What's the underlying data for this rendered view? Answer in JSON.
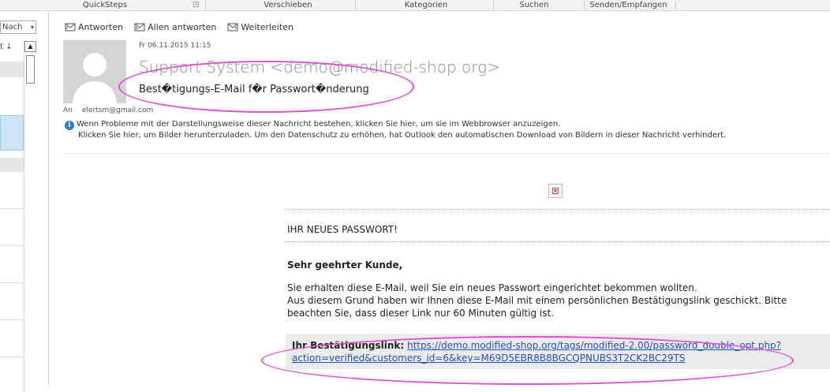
{
  "ribbon": {
    "groups": [
      "QuickSteps",
      "Verschieben",
      "Kategorien",
      "Suchen",
      "Senden/Empfangen"
    ]
  },
  "list": {
    "sort_label": "Nach",
    "sort_arrow": "t ↓"
  },
  "actions": {
    "reply": "Antworten",
    "reply_all": "Allen antworten",
    "forward": "Weiterleiten"
  },
  "message": {
    "date": "Fr 06.11.2015 11:15",
    "sender": "Support System <demo@modified-shop.org>",
    "subject": "Best�tigungs-E-Mail f�r Passwort�nderung",
    "to_label": "An",
    "to_address": "elertsm@gmail.com",
    "info_line1": "Wenn Probleme mit der Darstellungsweise dieser Nachricht bestehen, klicken Sie hier, um sie im Webbrowser anzuzeigen.",
    "info_line2": "Klicken Sie hier, um Bilder herunterzuladen. Um den Datenschutz zu erhöhen, hat Outlook den automatischen Download von Bildern in dieser Nachricht verhindert."
  },
  "body": {
    "heading": "IHR NEUES PASSWORT!",
    "greeting": "Sehr geehrter Kunde,",
    "para1": "Sie erhalten diese E-Mail, weil Sie ein neues Passwort eingerichtet bekommen wollten.",
    "para2": "Aus diesem Grund haben wir Ihnen diese E-Mail mit einem persönlichen Bestätigungslink geschickt. Bitte beachten Sie, dass dieser Link nur 60 Minuten gültig ist.",
    "link_label": "Ihr Bestätigungslink:",
    "link_line1": "https://demo.modified-shop.org/tags/modified-2.00/password_double_opt.php?",
    "link_line2": "action=verified&customers_id=6&key=M69D5EBR8B8BGCQPNUBS3T2CK2BC29TS"
  },
  "colors": {
    "annotation": "#e14fd2",
    "link": "#1f4fc3",
    "info_icon": "#2f79c9"
  }
}
